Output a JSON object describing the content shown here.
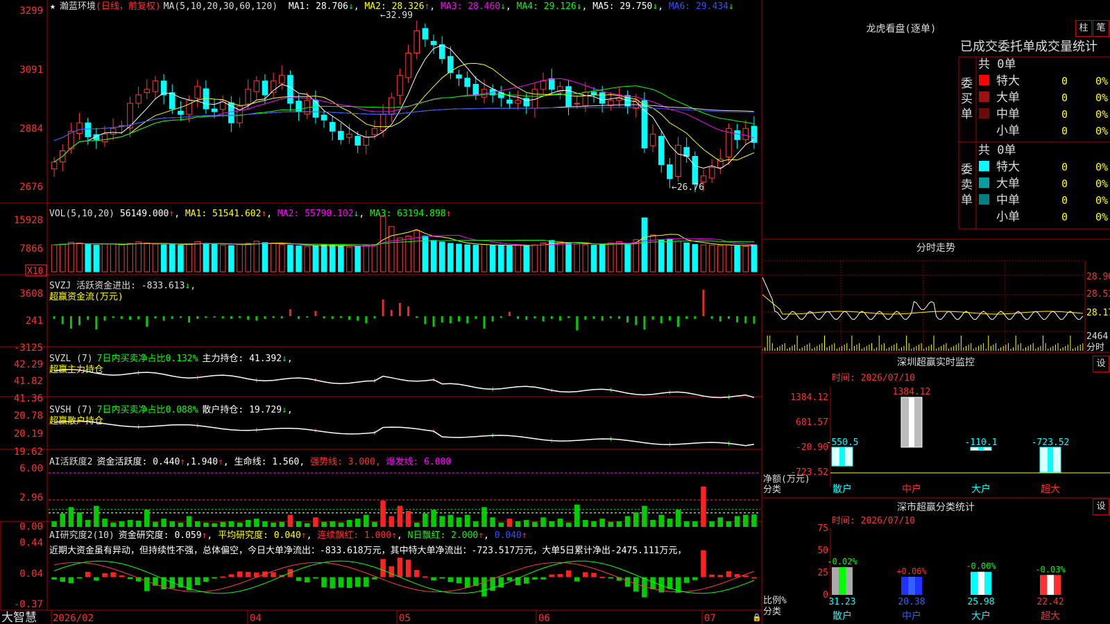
{
  "stock": {
    "name": "瀚蓝环境",
    "period": "(日线，前复权)"
  },
  "ma_legend": {
    "label": "MA(5,10,20,30,60,120)",
    "items": [
      {
        "name": "MA1",
        "value": "28.706",
        "dir": "↓",
        "color": "#ffffff"
      },
      {
        "name": "MA2",
        "value": "28.326",
        "dir": "↑",
        "color": "#ffff00"
      },
      {
        "name": "MA3",
        "value": "28.460",
        "dir": "↓",
        "color": "#ff00ff"
      },
      {
        "name": "MA4",
        "value": "29.126",
        "dir": "↓",
        "color": "#00ff00"
      },
      {
        "name": "MA5",
        "value": "29.750",
        "dir": "↓",
        "color": "#dddddd"
      },
      {
        "name": "MA6",
        "value": "29.434",
        "dir": "↓",
        "color": "#3050ff"
      }
    ]
  },
  "price_axis": [
    "3299",
    "3091",
    "2884",
    "2676"
  ],
  "annotations": {
    "high": "32.99",
    "low": "26.76"
  },
  "vol_legend": {
    "label": "VOL(5,10,20)",
    "value": "56149.000",
    "items": [
      {
        "name": "MA1",
        "value": "51541.602",
        "color": "#ffff00"
      },
      {
        "name": "MA2",
        "value": "55790.102",
        "color": "#ff00ff"
      },
      {
        "name": "MA3",
        "value": "63194.898",
        "color": "#00ff00"
      }
    ],
    "unit": "X10"
  },
  "vol_axis": [
    "15928",
    "7866"
  ],
  "svzj": {
    "line1": "SVZJ  活跃资金进出: -833.613",
    "line2": "超赢资金流(万元)",
    "axis": [
      "3608",
      "241",
      "-3125"
    ]
  },
  "svzl": {
    "label": "SVZL (7)",
    "green": "7日内买卖净占比0.132%",
    "white": "主力持仓: 41.392",
    "sub": "超赢主力持仓",
    "axis": [
      "42.29",
      "41.82",
      "41.36"
    ]
  },
  "svsh": {
    "label": "SVSH (7)",
    "green": "7日内买卖净占比0.088%",
    "white": "散户持仓: 19.729",
    "sub": "超赢散户持仓",
    "axis": [
      "20.78",
      "20.19",
      "19.62"
    ]
  },
  "ai1": {
    "title": "AI活跃度2",
    "t1": "资金活跃度: 0.440",
    "t2": "1.940",
    "t3": "生命线: 1.560",
    "t4": "强势线: 3.000",
    "t5": "爆发线: 6.000",
    "axis": [
      "6.00",
      "2.96",
      "0.00"
    ]
  },
  "ai2": {
    "title": "AI研究度2(10)",
    "t1": "资金研究度: 0.059",
    "t2": "平均研究度: 0.040",
    "t3": "连续飘红: 1.000",
    "t4": "N日飘红: 2.000",
    "t5": "0.040",
    "axis": [
      "0.44",
      "0.04",
      "-0.37"
    ],
    "comment": "近期大资金虽有异动，但持续性不强，总体偏空，今日大单净流出：-833.618万元，其中特大单净流出：-723.517万元，大单5日累计净出-2475.111万元，"
  },
  "date_axis": [
    "2026/02",
    "04",
    "05",
    "06",
    "07"
  ],
  "footer_brand": "大智慧",
  "dragon": {
    "title": "龙虎看盘(逐单)",
    "btn1": "柱",
    "btn2": "笔",
    "heading": "已成交委托单成交量统计",
    "buy": {
      "side": "委买单",
      "total": "共 0单",
      "rows": [
        {
          "label": "特大",
          "color": "#ff0000",
          "count": "0",
          "pct": "0%"
        },
        {
          "label": "大单",
          "color": "#a01010",
          "count": "0",
          "pct": "0%"
        },
        {
          "label": "中单",
          "color": "#6a0a0a",
          "count": "0",
          "pct": "0%"
        },
        {
          "label": "小单",
          "color": "",
          "count": "0",
          "pct": "0%"
        }
      ]
    },
    "sell": {
      "side": "委卖单",
      "total": "共 0单",
      "rows": [
        {
          "label": "特大",
          "color": "#00ffff",
          "count": "0",
          "pct": "0%"
        },
        {
          "label": "大单",
          "color": "#00a0a0",
          "count": "0",
          "pct": "0%"
        },
        {
          "label": "中单",
          "color": "#008080",
          "count": "0",
          "pct": "0%"
        },
        {
          "label": "小单",
          "color": "",
          "count": "0",
          "pct": "0%"
        }
      ]
    }
  },
  "intraday": {
    "title": "分时走势",
    "prices": [
      "28.90",
      "28.53",
      "28.17"
    ],
    "volume": "2464",
    "vol_label": "分时"
  },
  "sz_monitor": {
    "title": "深圳超赢实时监控",
    "btn": "设",
    "time": "时间: 2026/07/10",
    "ylabels": [
      "1384.12",
      "681.57",
      "-20.90",
      "-723.52"
    ],
    "axis_title": "净额(万元)",
    "axis_title2": "分类"
  },
  "sz_stats": {
    "title": "深市超赢分类统计",
    "btn": "设",
    "time": "时间: 2026/07/10",
    "ylabels": [
      "75",
      "50",
      "25",
      "0"
    ],
    "axis_title": "比例%",
    "axis_title2": "分类"
  },
  "chart_data": [
    {
      "type": "candlestick",
      "title": "瀚蓝环境 (日线，前复权)",
      "ylim": [
        26.3,
        33.3
      ],
      "x_labels": [
        "2026/02",
        "04",
        "05",
        "06",
        "07"
      ],
      "close": [
        27.7,
        28.1,
        28.8,
        29.1,
        28.6,
        28.5,
        28.7,
        28.9,
        29.0,
        29.8,
        30.1,
        30.3,
        30.6,
        30.1,
        29.6,
        29.4,
        29.9,
        30.4,
        29.6,
        29.5,
        29.9,
        29.1,
        29.7,
        30.3,
        30.6,
        30.1,
        30.6,
        30.8,
        29.8,
        29.5,
        29.9,
        29.3,
        29.2,
        28.8,
        28.5,
        28.7,
        28.3,
        28.6,
        28.9,
        29.4,
        30.0,
        30.8,
        31.6,
        32.4,
        32.1,
        31.9,
        31.4,
        30.9,
        30.7,
        30.4,
        30.1,
        30.3,
        30.1,
        30.0,
        29.8,
        29.9,
        29.7,
        30.3,
        30.6,
        30.3,
        30.4,
        29.7,
        29.8,
        30.2,
        30.1,
        29.8,
        29.9,
        30.0,
        29.7,
        29.9,
        28.2,
        28.7,
        27.6,
        27.1,
        28.3,
        27.9,
        26.9,
        27.2,
        27.5,
        27.8,
        28.9,
        28.5,
        28.9,
        28.4
      ],
      "ma": [
        {
          "name": "MA1",
          "last": 28.706
        },
        {
          "name": "MA2",
          "last": 28.326
        },
        {
          "name": "MA3",
          "last": 28.46
        },
        {
          "name": "MA4",
          "last": 29.126
        },
        {
          "name": "MA5",
          "last": 29.75
        },
        {
          "name": "MA6",
          "last": 29.434
        }
      ],
      "high_label": 32.99,
      "low_label": 26.76
    },
    {
      "type": "bar",
      "title": "VOL(5,10,20)",
      "ylim": [
        0,
        17500
      ],
      "last": 56149.0,
      "scale": "X10",
      "values": [
        7400,
        7600,
        8100,
        7900,
        7500,
        7300,
        7600,
        7700,
        7400,
        7800,
        8200,
        7900,
        7600,
        7400,
        7500,
        7300,
        7700,
        8300,
        7800,
        7600,
        7300,
        7200,
        7500,
        7800,
        8400,
        8000,
        7700,
        7500,
        7300,
        7100,
        6900,
        7200,
        7400,
        7300,
        7000,
        6800,
        7100,
        7300,
        7500,
        15200,
        12400,
        9300,
        9800,
        11300,
        9800,
        8600,
        8200,
        7800,
        7600,
        7400,
        7300,
        7500,
        7200,
        7300,
        7100,
        7300,
        7200,
        7400,
        7900,
        8600,
        8300,
        7800,
        7600,
        7400,
        7300,
        7600,
        7900,
        8300,
        7400,
        8800,
        14800,
        10100,
        8800,
        9000,
        8400,
        7900,
        7500,
        7400,
        7300,
        7200,
        7400,
        7100,
        7000,
        7400
      ]
    },
    {
      "type": "bar",
      "title": "SVZJ 超赢资金流(万元)",
      "ylim": [
        -3125,
        3608
      ],
      "last": -833.613,
      "values": [
        -300,
        -900,
        -1400,
        -1000,
        -400,
        -1500,
        -500,
        -200,
        -300,
        -400,
        -350,
        -1200,
        -250,
        -500,
        -300,
        -200,
        -700,
        -300,
        -200,
        -150,
        -250,
        -300,
        -200,
        -400,
        -500,
        -300,
        -200,
        -250,
        800,
        -300,
        -150,
        600,
        -250,
        -300,
        -200,
        -400,
        -500,
        -800,
        -250,
        1900,
        700,
        1500,
        1100,
        -200,
        -900,
        -1200,
        -700,
        -800,
        -600,
        -800,
        -300,
        -1400,
        -600,
        -200,
        500,
        -300,
        -400,
        -250,
        -600,
        -300,
        -500,
        -200,
        -1600,
        -400,
        -300,
        -500,
        -250,
        -300,
        -700,
        -1000,
        -1500,
        -400,
        -800,
        -500,
        -1200,
        -300,
        -300,
        3000,
        -300,
        -600,
        -300,
        -700,
        -800,
        -833
      ]
    },
    {
      "type": "line",
      "title": "SVZL 超赢主力持仓",
      "ylim": [
        41.36,
        42.29
      ],
      "last": 41.392
    },
    {
      "type": "line",
      "title": "SVSH 超赢散户持仓",
      "ylim": [
        19.62,
        20.78
      ],
      "last": 19.729
    },
    {
      "type": "bar",
      "title": "AI活跃度2",
      "ylim": [
        0,
        6.0
      ],
      "last": 0.44,
      "lines": {
        "生命线": 1.56,
        "强势线": 3.0,
        "爆发线": 6.0
      }
    },
    {
      "type": "bar",
      "title": "AI研究度2(10)",
      "ylim": [
        -0.37,
        0.44
      ],
      "last": 0.059,
      "average": 0.04
    },
    {
      "type": "bar",
      "title": "深圳超赢实时监控",
      "categories": [
        "散户",
        "中户",
        "大户",
        "超大"
      ],
      "values": [
        -550.5,
        1384.12,
        -110.1,
        -723.52
      ],
      "ylim": [
        -723.52,
        1384.12
      ]
    },
    {
      "type": "bar",
      "title": "深市超赢分类统计",
      "categories": [
        "散户",
        "中户",
        "大户",
        "超大"
      ],
      "values": [
        31.23,
        20.38,
        25.98,
        22.42
      ],
      "changes": [
        "-0.02%",
        "+0.06%",
        "-0.00%",
        "-0.03%"
      ],
      "ylim": [
        0,
        75
      ]
    }
  ]
}
